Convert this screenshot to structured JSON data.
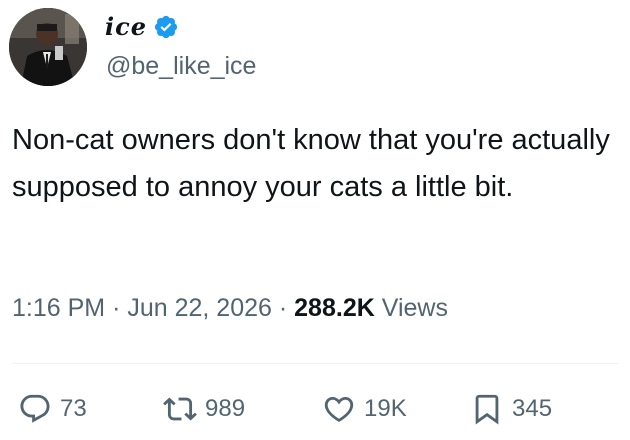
{
  "author": {
    "display_name": "ice",
    "handle": "@be_like_ice",
    "verified_color": "#1d9bf0"
  },
  "tweet": {
    "text": "Non-cat owners don't know that you're actually supposed to annoy your cats a little bit."
  },
  "meta": {
    "time": "1:16 PM",
    "date": "Jun 22, 2026",
    "views_count": "288.2K",
    "views_label": "Views",
    "separator": "·"
  },
  "actions": {
    "replies": "73",
    "reposts": "989",
    "likes": "19K",
    "bookmarks": "345"
  },
  "icons": {
    "reply": "reply-icon",
    "repost": "repost-icon",
    "like": "heart-icon",
    "bookmark": "bookmark-icon",
    "verified": "verified-badge-icon"
  }
}
